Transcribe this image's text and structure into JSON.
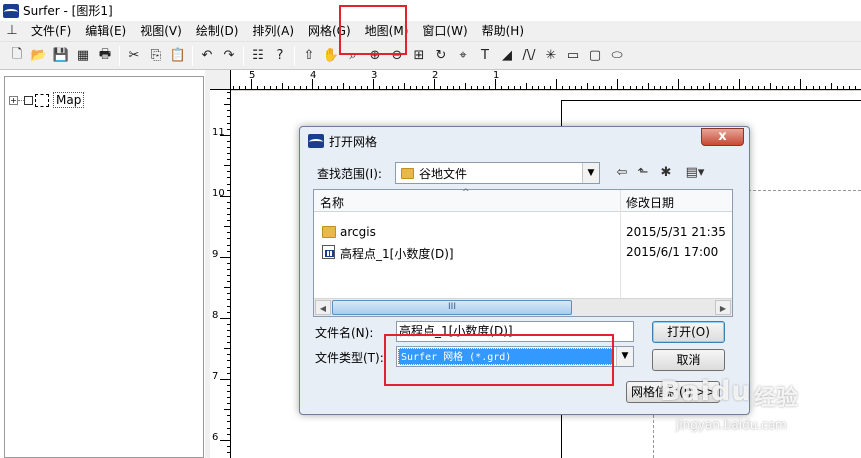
{
  "window": {
    "title": "Surfer - [图形1]"
  },
  "menu": {
    "items": [
      "文件(F)",
      "编辑(E)",
      "视图(V)",
      "绘制(D)",
      "排列(A)",
      "网格(G)",
      "地图(M)",
      "窗口(W)",
      "帮助(H)"
    ]
  },
  "toolbar": {
    "icons": [
      "new-file-icon",
      "open-folder-icon",
      "save-icon",
      "spreadsheet-icon",
      "print-icon",
      "cut-icon",
      "copy-icon",
      "paste-icon",
      "undo-icon",
      "redo-icon",
      "object-manager-icon",
      "help-pointer-icon",
      "select-arrow-icon",
      "pan-hand-icon",
      "zoom-icon",
      "zoom-in-icon",
      "zoom-out-icon",
      "zoom-rect-icon",
      "rotate-icon",
      "reshape-icon",
      "text-icon",
      "polygon-icon",
      "polyline-icon",
      "symbol-icon",
      "rectangle-icon",
      "rounded-rectangle-icon",
      "ellipse-icon"
    ],
    "glyphs": [
      "🗋",
      "📂",
      "💾",
      "▦",
      "🖶",
      "✂",
      "⎘",
      "📋",
      "↶",
      "↷",
      "☷",
      "?",
      "⇧",
      "✋",
      "⌕",
      "⊕",
      "⊖",
      "⊞",
      "↻",
      "⌖",
      "T",
      "◢",
      "/\\/",
      "✳",
      "▭",
      "▢",
      "⬭"
    ]
  },
  "tree": {
    "expander": "+",
    "root_label": "Map"
  },
  "ruler": {
    "top_labels": [
      "5",
      "4",
      "3",
      "2",
      "1"
    ],
    "left_labels": [
      "11",
      "10",
      "9",
      "8",
      "7",
      "6"
    ]
  },
  "dialog": {
    "title": "打开网格",
    "close_glyph": "x",
    "look_in_label": "查找范围(I):",
    "look_in_value": "谷地文件",
    "nav_glyphs": [
      "⇦",
      "⬑",
      "✱",
      "▤▾"
    ],
    "columns": {
      "name": "名称",
      "date": "修改日期"
    },
    "files": [
      {
        "name": "arcgis",
        "date": "2015/5/31 21:35",
        "type": "folder"
      },
      {
        "name": "高程点_1[小数度(D)]",
        "date": "2015/6/1 17:00",
        "type": "grd"
      }
    ],
    "scroll_thumb": "III",
    "file_name_label": "文件名(N):",
    "file_name_value": "高程点_1[小数度(D)]",
    "file_type_label": "文件类型(T):",
    "file_type_value": "Surfer 网格 (*.grd)",
    "open_button": "打开(O)",
    "cancel_button": "取消",
    "grid_info_button": "网格信息(I) >>"
  },
  "watermark": {
    "logo": "Baidu",
    "sub": "经验",
    "url": "jingyan.baidu.com"
  },
  "colors": {
    "highlight": "#e0232f",
    "selection": "#3399ff",
    "app_blue": "#1b3d8f"
  }
}
